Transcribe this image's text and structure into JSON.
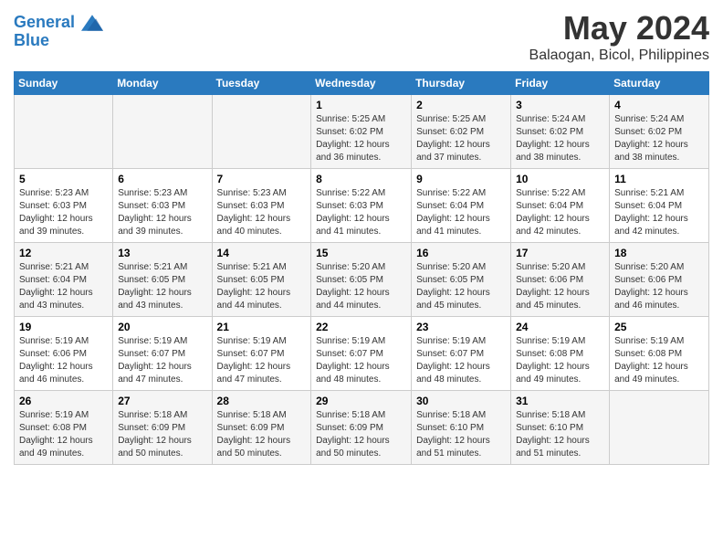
{
  "header": {
    "logo_line1": "General",
    "logo_line2": "Blue",
    "month_title": "May 2024",
    "location": "Balaogan, Bicol, Philippines"
  },
  "days_of_week": [
    "Sunday",
    "Monday",
    "Tuesday",
    "Wednesday",
    "Thursday",
    "Friday",
    "Saturday"
  ],
  "weeks": [
    [
      {
        "day": "",
        "sunrise": "",
        "sunset": "",
        "daylight": ""
      },
      {
        "day": "",
        "sunrise": "",
        "sunset": "",
        "daylight": ""
      },
      {
        "day": "",
        "sunrise": "",
        "sunset": "",
        "daylight": ""
      },
      {
        "day": "1",
        "sunrise": "Sunrise: 5:25 AM",
        "sunset": "Sunset: 6:02 PM",
        "daylight": "Daylight: 12 hours and 36 minutes."
      },
      {
        "day": "2",
        "sunrise": "Sunrise: 5:25 AM",
        "sunset": "Sunset: 6:02 PM",
        "daylight": "Daylight: 12 hours and 37 minutes."
      },
      {
        "day": "3",
        "sunrise": "Sunrise: 5:24 AM",
        "sunset": "Sunset: 6:02 PM",
        "daylight": "Daylight: 12 hours and 38 minutes."
      },
      {
        "day": "4",
        "sunrise": "Sunrise: 5:24 AM",
        "sunset": "Sunset: 6:02 PM",
        "daylight": "Daylight: 12 hours and 38 minutes."
      }
    ],
    [
      {
        "day": "5",
        "sunrise": "Sunrise: 5:23 AM",
        "sunset": "Sunset: 6:03 PM",
        "daylight": "Daylight: 12 hours and 39 minutes."
      },
      {
        "day": "6",
        "sunrise": "Sunrise: 5:23 AM",
        "sunset": "Sunset: 6:03 PM",
        "daylight": "Daylight: 12 hours and 39 minutes."
      },
      {
        "day": "7",
        "sunrise": "Sunrise: 5:23 AM",
        "sunset": "Sunset: 6:03 PM",
        "daylight": "Daylight: 12 hours and 40 minutes."
      },
      {
        "day": "8",
        "sunrise": "Sunrise: 5:22 AM",
        "sunset": "Sunset: 6:03 PM",
        "daylight": "Daylight: 12 hours and 41 minutes."
      },
      {
        "day": "9",
        "sunrise": "Sunrise: 5:22 AM",
        "sunset": "Sunset: 6:04 PM",
        "daylight": "Daylight: 12 hours and 41 minutes."
      },
      {
        "day": "10",
        "sunrise": "Sunrise: 5:22 AM",
        "sunset": "Sunset: 6:04 PM",
        "daylight": "Daylight: 12 hours and 42 minutes."
      },
      {
        "day": "11",
        "sunrise": "Sunrise: 5:21 AM",
        "sunset": "Sunset: 6:04 PM",
        "daylight": "Daylight: 12 hours and 42 minutes."
      }
    ],
    [
      {
        "day": "12",
        "sunrise": "Sunrise: 5:21 AM",
        "sunset": "Sunset: 6:04 PM",
        "daylight": "Daylight: 12 hours and 43 minutes."
      },
      {
        "day": "13",
        "sunrise": "Sunrise: 5:21 AM",
        "sunset": "Sunset: 6:05 PM",
        "daylight": "Daylight: 12 hours and 43 minutes."
      },
      {
        "day": "14",
        "sunrise": "Sunrise: 5:21 AM",
        "sunset": "Sunset: 6:05 PM",
        "daylight": "Daylight: 12 hours and 44 minutes."
      },
      {
        "day": "15",
        "sunrise": "Sunrise: 5:20 AM",
        "sunset": "Sunset: 6:05 PM",
        "daylight": "Daylight: 12 hours and 44 minutes."
      },
      {
        "day": "16",
        "sunrise": "Sunrise: 5:20 AM",
        "sunset": "Sunset: 6:05 PM",
        "daylight": "Daylight: 12 hours and 45 minutes."
      },
      {
        "day": "17",
        "sunrise": "Sunrise: 5:20 AM",
        "sunset": "Sunset: 6:06 PM",
        "daylight": "Daylight: 12 hours and 45 minutes."
      },
      {
        "day": "18",
        "sunrise": "Sunrise: 5:20 AM",
        "sunset": "Sunset: 6:06 PM",
        "daylight": "Daylight: 12 hours and 46 minutes."
      }
    ],
    [
      {
        "day": "19",
        "sunrise": "Sunrise: 5:19 AM",
        "sunset": "Sunset: 6:06 PM",
        "daylight": "Daylight: 12 hours and 46 minutes."
      },
      {
        "day": "20",
        "sunrise": "Sunrise: 5:19 AM",
        "sunset": "Sunset: 6:07 PM",
        "daylight": "Daylight: 12 hours and 47 minutes."
      },
      {
        "day": "21",
        "sunrise": "Sunrise: 5:19 AM",
        "sunset": "Sunset: 6:07 PM",
        "daylight": "Daylight: 12 hours and 47 minutes."
      },
      {
        "day": "22",
        "sunrise": "Sunrise: 5:19 AM",
        "sunset": "Sunset: 6:07 PM",
        "daylight": "Daylight: 12 hours and 48 minutes."
      },
      {
        "day": "23",
        "sunrise": "Sunrise: 5:19 AM",
        "sunset": "Sunset: 6:07 PM",
        "daylight": "Daylight: 12 hours and 48 minutes."
      },
      {
        "day": "24",
        "sunrise": "Sunrise: 5:19 AM",
        "sunset": "Sunset: 6:08 PM",
        "daylight": "Daylight: 12 hours and 49 minutes."
      },
      {
        "day": "25",
        "sunrise": "Sunrise: 5:19 AM",
        "sunset": "Sunset: 6:08 PM",
        "daylight": "Daylight: 12 hours and 49 minutes."
      }
    ],
    [
      {
        "day": "26",
        "sunrise": "Sunrise: 5:19 AM",
        "sunset": "Sunset: 6:08 PM",
        "daylight": "Daylight: 12 hours and 49 minutes."
      },
      {
        "day": "27",
        "sunrise": "Sunrise: 5:18 AM",
        "sunset": "Sunset: 6:09 PM",
        "daylight": "Daylight: 12 hours and 50 minutes."
      },
      {
        "day": "28",
        "sunrise": "Sunrise: 5:18 AM",
        "sunset": "Sunset: 6:09 PM",
        "daylight": "Daylight: 12 hours and 50 minutes."
      },
      {
        "day": "29",
        "sunrise": "Sunrise: 5:18 AM",
        "sunset": "Sunset: 6:09 PM",
        "daylight": "Daylight: 12 hours and 50 minutes."
      },
      {
        "day": "30",
        "sunrise": "Sunrise: 5:18 AM",
        "sunset": "Sunset: 6:10 PM",
        "daylight": "Daylight: 12 hours and 51 minutes."
      },
      {
        "day": "31",
        "sunrise": "Sunrise: 5:18 AM",
        "sunset": "Sunset: 6:10 PM",
        "daylight": "Daylight: 12 hours and 51 minutes."
      },
      {
        "day": "",
        "sunrise": "",
        "sunset": "",
        "daylight": ""
      }
    ]
  ]
}
